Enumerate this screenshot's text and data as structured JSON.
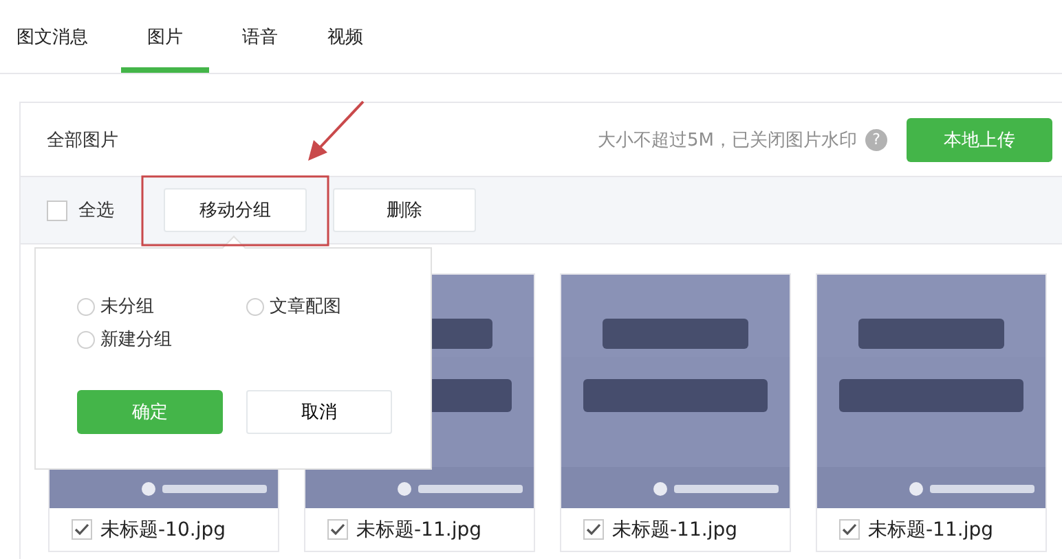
{
  "tabs": [
    {
      "label": "图文消息",
      "selected": false
    },
    {
      "label": "图片",
      "selected": true
    },
    {
      "label": "语音",
      "selected": false
    },
    {
      "label": "视频",
      "selected": false
    }
  ],
  "header": {
    "title": "全部图片",
    "hint": "大小不超过5M，已关闭图片水印",
    "help_icon": "?",
    "upload_button": "本地上传"
  },
  "toolbar": {
    "select_all": {
      "label": "全选",
      "checked": false
    },
    "move_button": "移动分组",
    "delete_button": "删除"
  },
  "move_popover": {
    "options": [
      {
        "label": "未分组",
        "selected": false
      },
      {
        "label": "文章配图",
        "selected": false
      },
      {
        "label": "新建分组",
        "selected": false
      }
    ],
    "confirm": "确定",
    "cancel": "取消"
  },
  "images": [
    {
      "kind": "picture",
      "filename": "未标题-10.jpg",
      "checked": true
    },
    {
      "kind": "picture",
      "filename": "未标题-11.jpg",
      "checked": true
    },
    {
      "kind": "picture",
      "filename": "未标题-11.jpg",
      "checked": true
    },
    {
      "kind": "picture",
      "filename": "未标题-11.jpg",
      "checked": true
    }
  ]
}
